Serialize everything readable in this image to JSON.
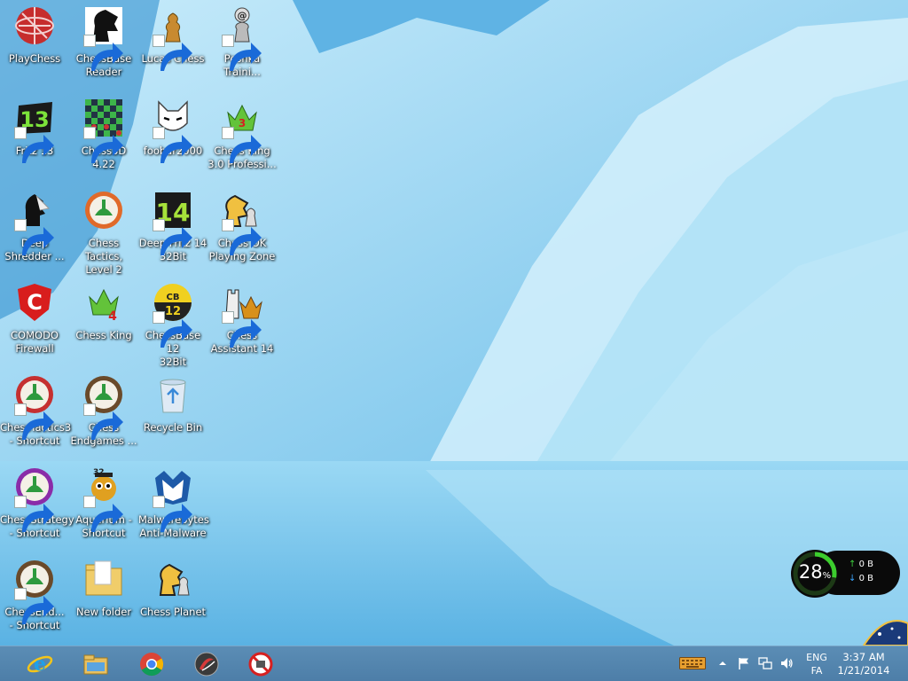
{
  "desktop": {
    "icons": [
      {
        "label": "PlayChess",
        "icon": "playchess-icon",
        "shortcut": false
      },
      {
        "label": "Fritz 13",
        "icon": "fritz13-icon",
        "shortcut": true
      },
      {
        "label": "Deep\nShredder ...",
        "icon": "shredder-icon",
        "shortcut": true
      },
      {
        "label": "COMODO\nFirewall",
        "icon": "comodo-icon",
        "shortcut": false
      },
      {
        "label": "ChessTactics3\n- Shortcut",
        "icon": "chesstactics3-icon",
        "shortcut": true
      },
      {
        "label": "ChessStrategy\n- Shortcut",
        "icon": "chessstrategy-icon",
        "shortcut": true
      },
      {
        "label": "ChessEnd...\n- Shortcut",
        "icon": "chessend-icon",
        "shortcut": true
      },
      {
        "label": "ChessBase\nReader",
        "icon": "chessbase-reader-icon",
        "shortcut": true
      },
      {
        "label": "Chess3D 4.22",
        "icon": "chess3d-icon",
        "shortcut": true
      },
      {
        "label": "Chess Tactics,\nLevel 2",
        "icon": "chess-tactics-icon",
        "shortcut": false
      },
      {
        "label": "Chess King",
        "icon": "chess-king-icon",
        "shortcut": false
      },
      {
        "label": "Chess\nEndgames ...",
        "icon": "chess-endgames-icon",
        "shortcut": true
      },
      {
        "label": "Aquarium -\nShortcut",
        "icon": "aquarium-icon",
        "shortcut": true
      },
      {
        "label": "New folder",
        "icon": "folder-icon",
        "shortcut": false
      },
      {
        "label": "Lucas Chess",
        "icon": "lucas-chess-icon",
        "shortcut": true
      },
      {
        "label": "foobar2000",
        "icon": "foobar2000-icon",
        "shortcut": true
      },
      {
        "label": "Deep Fritz 14\n32Bit",
        "icon": "deep-fritz14-icon",
        "shortcut": true
      },
      {
        "label": "ChessBase 12\n32Bit",
        "icon": "chessbase12-icon",
        "shortcut": true
      },
      {
        "label": "Recycle Bin",
        "icon": "recycle-bin-icon",
        "shortcut": false
      },
      {
        "label": "Malwarebytes\nAnti-Malware",
        "icon": "malwarebytes-icon",
        "shortcut": true
      },
      {
        "label": "Chess Planet",
        "icon": "chess-planet-icon",
        "shortcut": false
      },
      {
        "label": "Peshka\nTraini...",
        "icon": "peshka-icon",
        "shortcut": true
      },
      {
        "label": "Chess King\n3.0 Professi...",
        "icon": "chess-king-pro-icon",
        "shortcut": true
      },
      {
        "label": "Chess OK\nPlaying Zone",
        "icon": "chessok-icon",
        "shortcut": true
      },
      {
        "label": "Chess\nAssistant 14",
        "icon": "chess-assistant-icon",
        "shortcut": true
      }
    ]
  },
  "net_meter": {
    "percent": "28",
    "percent_unit": "%",
    "upload": "0 B",
    "download": "0 B",
    "level": 0.28
  },
  "taskbar": {
    "pinned": [
      {
        "name": "internet-explorer-icon"
      },
      {
        "name": "file-explorer-icon"
      },
      {
        "name": "chrome-icon"
      },
      {
        "name": "app-swirl-icon"
      },
      {
        "name": "blocked-app-icon"
      }
    ],
    "tray": {
      "lang_line1": "ENG",
      "lang_line2": "FA",
      "time": "3:37 AM",
      "date": "1/21/2014"
    }
  },
  "colors": {
    "taskbar": "#4d7ea8",
    "meter_ring": "#3ccd2e",
    "upload_arrow": "#3dd23d",
    "download_arrow": "#39a6ff"
  }
}
